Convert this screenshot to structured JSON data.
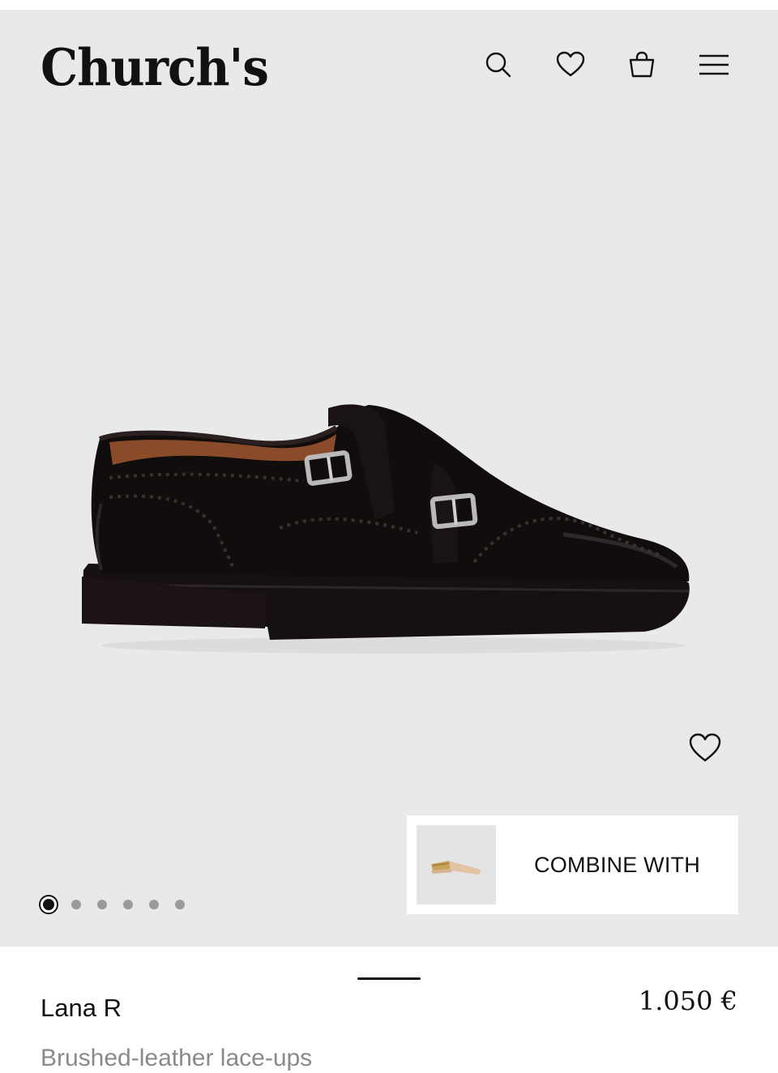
{
  "header": {
    "logo_text": "Church's",
    "icons": [
      "search-icon",
      "heart-icon",
      "shopping-bag-icon",
      "menu-icon"
    ]
  },
  "gallery": {
    "image_alt": "black-monk-strap-brogue-shoe",
    "slide_count": 6,
    "active_slide": 1,
    "combine_label": "COMBINE WITH"
  },
  "product": {
    "name": "Lana R",
    "price": "1.050 €",
    "description": "Brushed-leather lace-ups"
  },
  "colors": {
    "gallery_bg": "#e9e9e9",
    "text": "#111111",
    "muted": "#8a8a8a"
  }
}
